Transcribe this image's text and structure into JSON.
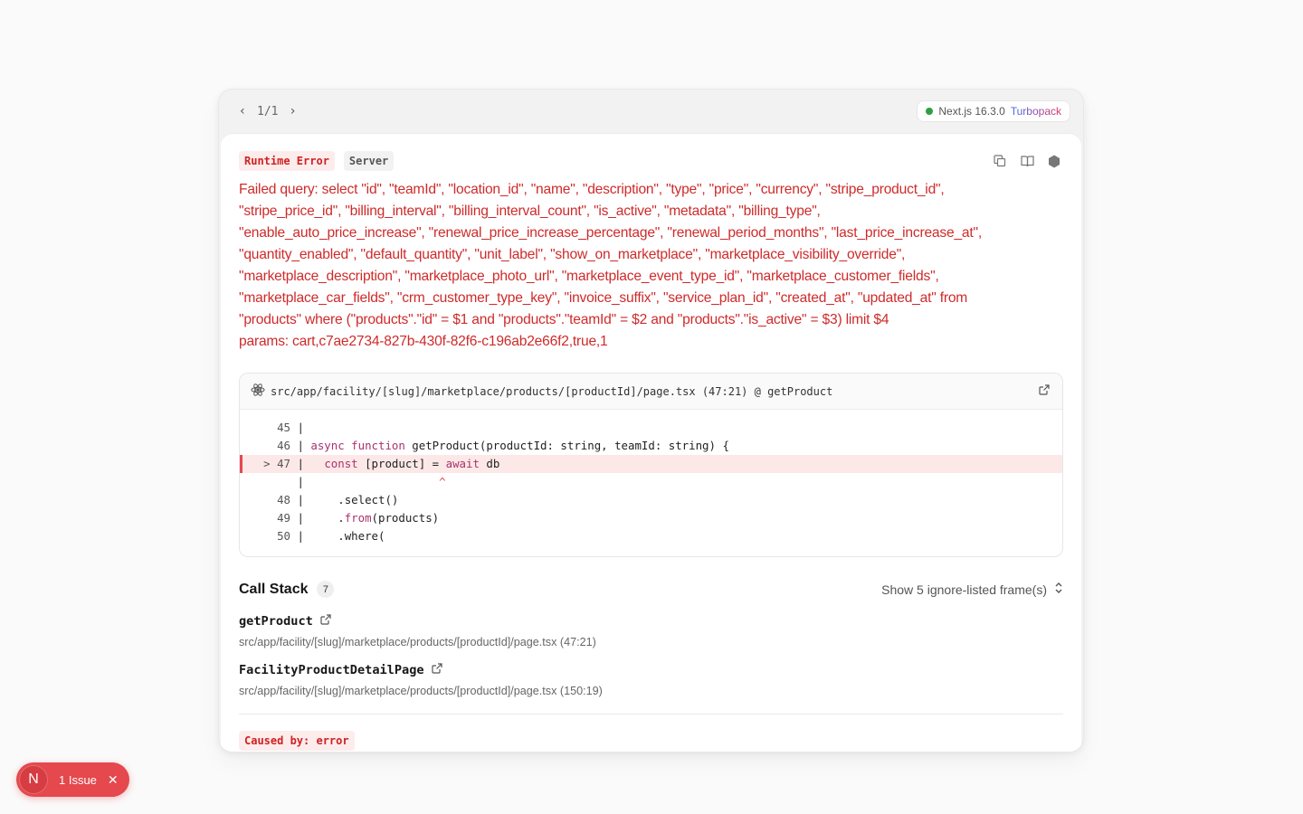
{
  "pager": {
    "prev": "‹",
    "position": "1/1",
    "next": "›"
  },
  "version": {
    "label": "Next.js 16.3.0",
    "bundler": "Turbopack"
  },
  "badges": {
    "type": "Runtime Error",
    "env": "Server"
  },
  "error": {
    "lines": [
      "Failed query: select \"id\", \"teamId\", \"location_id\", \"name\", \"description\", \"type\", \"price\", \"currency\", \"stripe_product_id\",",
      "\"stripe_price_id\", \"billing_interval\", \"billing_interval_count\", \"is_active\", \"metadata\", \"billing_type\",",
      "\"enable_auto_price_increase\", \"renewal_price_increase_percentage\", \"renewal_period_months\", \"last_price_increase_at\",",
      "\"quantity_enabled\", \"default_quantity\", \"unit_label\", \"show_on_marketplace\", \"marketplace_visibility_override\",",
      "\"marketplace_description\", \"marketplace_photo_url\", \"marketplace_event_type_id\", \"marketplace_customer_fields\",",
      "\"marketplace_car_fields\", \"crm_customer_type_key\", \"invoice_suffix\", \"service_plan_id\", \"created_at\", \"updated_at\" from",
      "\"products\" where (\"products\".\"id\" = $1 and \"products\".\"teamId\" = $2 and \"products\".\"is_active\" = $3) limit $4",
      "params: cart,c7ae2734-827b-430f-82f6-c196ab2e66f2,true,1"
    ]
  },
  "codeframe": {
    "path": "src/app/facility/[slug]/marketplace/products/[productId]/page.tsx (47:21) @ getProduct",
    "lines": [
      {
        "num": "45",
        "code": ""
      },
      {
        "num": "46",
        "pre": "",
        "kw": "async function",
        "code": " getProduct(productId: string, teamId: string) {"
      },
      {
        "num": "47",
        "prefix": ">",
        "pre": "  ",
        "kw": "const",
        "code": " [product] = ",
        "kw2": "await",
        "code2": " db"
      },
      {
        "num": "",
        "caret": "^"
      },
      {
        "num": "48",
        "code": "    .select()"
      },
      {
        "num": "49",
        "code": "    .from(products)",
        "from": true
      },
      {
        "num": "50",
        "code": "    .where("
      }
    ]
  },
  "callstack": {
    "title": "Call Stack",
    "count": "7",
    "toggle": "Show 5 ignore-listed frame(s)",
    "frames": [
      {
        "fn": "getProduct",
        "loc": "src/app/facility/[slug]/marketplace/products/[productId]/page.tsx (47:21)"
      },
      {
        "fn": "FacilityProductDetailPage",
        "loc": "src/app/facility/[slug]/marketplace/products/[productId]/page.tsx (150:19)"
      }
    ]
  },
  "caused_by": "Caused by: error",
  "issues": {
    "avatar": "N",
    "label": "1 Issue",
    "close": "✕"
  }
}
